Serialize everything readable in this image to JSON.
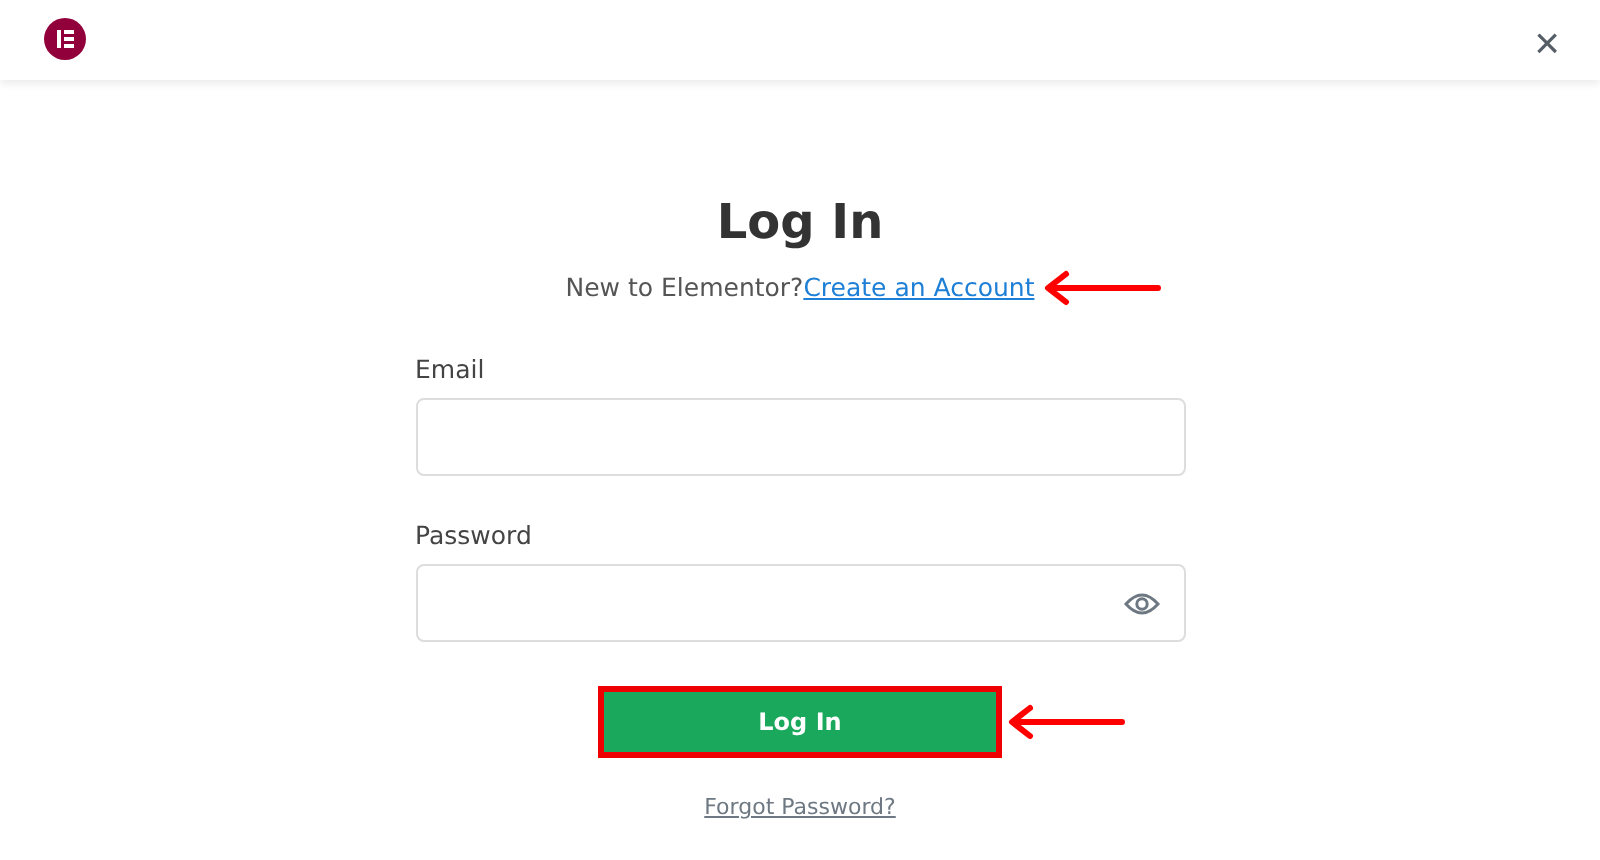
{
  "header": {
    "close_label": "×"
  },
  "title": "Log In",
  "signup": {
    "prompt": "New to Elementor?",
    "link": "Create an Account"
  },
  "fields": [
    {
      "label": "Email",
      "kind": "text"
    },
    {
      "label": "Password",
      "kind": "password"
    }
  ],
  "submit": "Log In",
  "forgot": "Forgot Password?"
}
